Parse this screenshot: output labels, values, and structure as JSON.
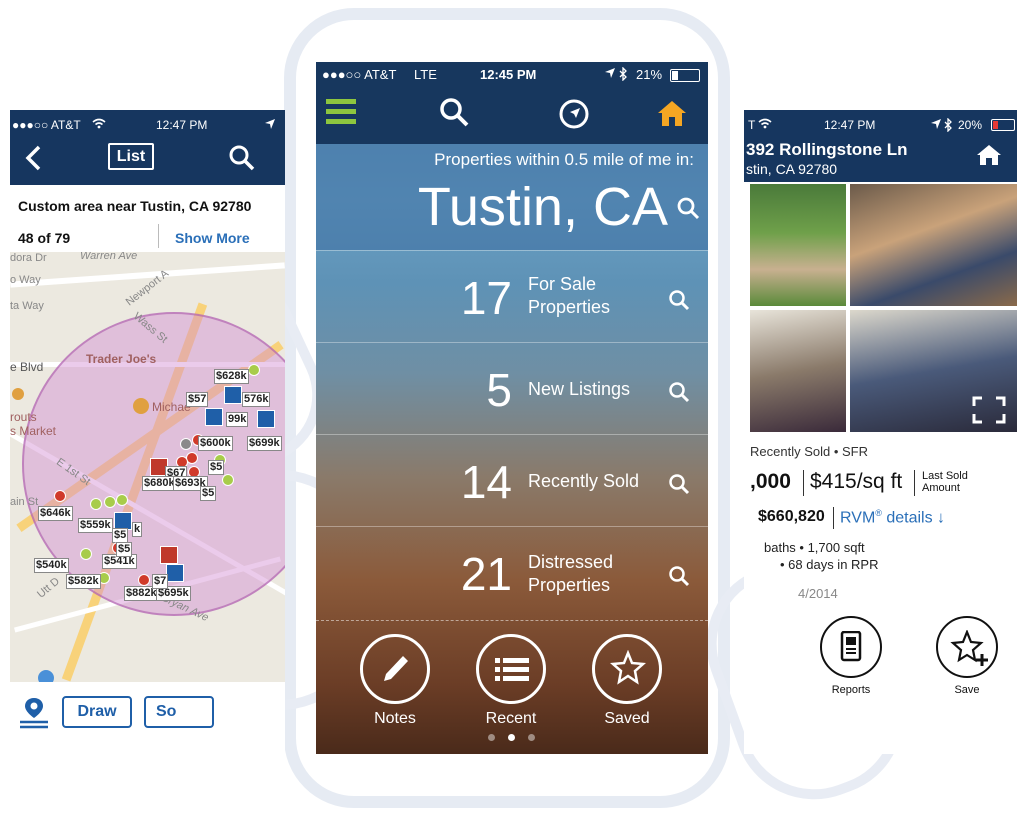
{
  "left": {
    "status": {
      "carrier": "●●●○○ AT&T",
      "wifi": "wifi-icon",
      "time": "12:47 PM"
    },
    "nav": {
      "back": "back-chevron-icon",
      "list_label": "List",
      "search": "search-icon"
    },
    "title": "Custom area near Tustin, CA 92780",
    "count": "48 of 79",
    "show_more": "Show More",
    "map_labels": [
      "dora Dr",
      "Warren Ave",
      "o Way",
      "ta Way",
      "Newport A",
      "Wass St",
      "e Blvd",
      "Trader Joe's",
      "Michae",
      "routs",
      "s Market",
      "E 1st St",
      "ain St",
      "Utt D",
      "Bryan Ave"
    ],
    "prices": [
      "$628k",
      "$57",
      "576k",
      "99k",
      "$600k",
      "$699k",
      "$67",
      "$5",
      "$680k",
      "$693k",
      "$5",
      "$646k",
      "$559k",
      "$5",
      "k",
      "$541k",
      "$5",
      "$540k",
      "$582k",
      "$882k",
      "$695k",
      "$7"
    ],
    "toolbar": {
      "draw": "Draw",
      "sort": "So"
    }
  },
  "center": {
    "status": {
      "carrier": "●●●○○ AT&T",
      "network": "LTE",
      "time": "12:45 PM",
      "battery": "21%"
    },
    "nav": {
      "menu": "menu-icon",
      "search": "search-icon",
      "locate": "compass-icon",
      "home": "home-icon"
    },
    "subtitle": "Properties within 0.5 mile of me in:",
    "city": "Tustin, CA",
    "rows": [
      {
        "count": "17",
        "line1": "For Sale",
        "line2": "Properties"
      },
      {
        "count": "5",
        "line1": "New Listings",
        "line2": ""
      },
      {
        "count": "14",
        "line1": "Recently Sold",
        "line2": ""
      },
      {
        "count": "21",
        "line1": "Distressed",
        "line2": "Properties"
      }
    ],
    "buttons": [
      {
        "label": "Notes",
        "icon": "pencil-icon"
      },
      {
        "label": "Recent",
        "icon": "list-icon"
      },
      {
        "label": "Saved",
        "icon": "star-icon"
      }
    ]
  },
  "right": {
    "status": {
      "carrier": "T",
      "time": "12:47 PM",
      "battery": "20%"
    },
    "address_line1": "392 Rollingstone Ln",
    "address_line2": "stin, CA 92780",
    "home": "home-icon",
    "sold_type": "Recently Sold • SFR",
    "price": ",000",
    "per_sqft": "$415/sq ft",
    "last_sold_1": "Last Sold",
    "last_sold_2": "Amount",
    "rvm_value": "$660,820",
    "rvm_link": "RVM",
    "rvm_link_sup": "®",
    "rvm_link_rest": " details ↓",
    "specs1": "baths • 1,700 sqft",
    "specs2": "• 68 days in RPR",
    "date": "4/2014",
    "actions": [
      {
        "label": "Reports",
        "icon": "report-icon"
      },
      {
        "label": "Save",
        "icon": "star-plus-icon"
      }
    ]
  }
}
